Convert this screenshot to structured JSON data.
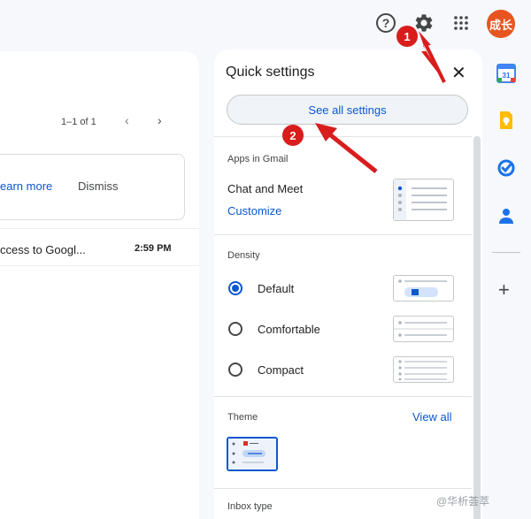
{
  "topbar": {
    "help_icon": "help-circle-icon",
    "help_glyph": "?",
    "settings_icon": "gear-icon",
    "apps_icon": "apps-grid-icon",
    "avatar_text": "成长"
  },
  "mail_list": {
    "pager": "1–1 of 1",
    "prev_glyph": "‹",
    "next_glyph": "›",
    "banner": {
      "learn_more": "earn more",
      "dismiss": "Dismiss"
    },
    "rows": [
      {
        "subject": "ccess to Googl...",
        "time": "2:59 PM"
      }
    ]
  },
  "quick_settings": {
    "title": "Quick settings",
    "close_glyph": "✕",
    "see_all_label": "See all settings",
    "apps_section": {
      "label": "Apps in Gmail",
      "item": "Chat and Meet",
      "customize_label": "Customize"
    },
    "density": {
      "label": "Density",
      "options": [
        {
          "label": "Default",
          "selected": true
        },
        {
          "label": "Comfortable",
          "selected": false
        },
        {
          "label": "Compact",
          "selected": false
        }
      ]
    },
    "theme": {
      "label": "Theme",
      "view_all_label": "View all"
    },
    "inbox_type": {
      "label": "Inbox type"
    }
  },
  "side_rail": {
    "calendar_day": "31",
    "items": [
      "calendar-icon",
      "keep-icon",
      "tasks-icon",
      "contacts-icon"
    ],
    "add_glyph": "+"
  },
  "annotations": {
    "badge_1": "1",
    "badge_2": "2",
    "color": "#d91c1c"
  },
  "watermark": "@华析荟萃",
  "colors": {
    "accent": "#0b57d0",
    "background": "#f6f8fc",
    "avatar": "#e8541f"
  }
}
